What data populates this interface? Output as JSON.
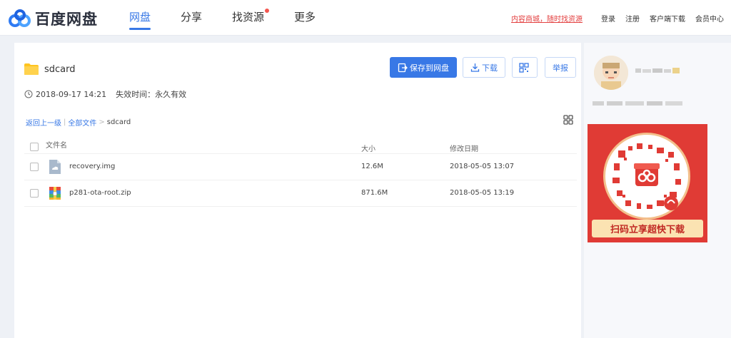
{
  "app": {
    "logo_text": "百度网盘"
  },
  "nav": {
    "items": [
      {
        "label": "网盘"
      },
      {
        "label": "分享"
      },
      {
        "label": "找资源"
      },
      {
        "label": "更多"
      }
    ]
  },
  "top": {
    "promo": "内容商城，随时找资源",
    "links": [
      "登录",
      "注册",
      "客户端下载",
      "会员中心"
    ]
  },
  "share": {
    "title": "sdcard",
    "date": "2018-09-17 14:21",
    "expire": "失效时间：永久有效"
  },
  "actions": {
    "save": "保存到网盘",
    "download": "下载",
    "report": "举报"
  },
  "breadcrumb": {
    "back": "返回上一级",
    "all": "全部文件",
    "sep": ">",
    "current": "sdcard"
  },
  "table": {
    "headers": {
      "name": "文件名",
      "size": "大小",
      "date": "修改日期"
    },
    "rows": [
      {
        "name": "recovery.img",
        "size": "12.6M",
        "date": "2018-05-05 13:07",
        "icon": "image-file-icon"
      },
      {
        "name": "p281-ota-root.zip",
        "size": "871.6M",
        "date": "2018-05-05 13:19",
        "icon": "zip-file-icon"
      }
    ]
  },
  "sidebar": {
    "qr_button": "扫码立享超快下载"
  },
  "colors": {
    "accent": "#3878e6",
    "promo": "#e34141",
    "qr_bg": "#e03b35"
  }
}
